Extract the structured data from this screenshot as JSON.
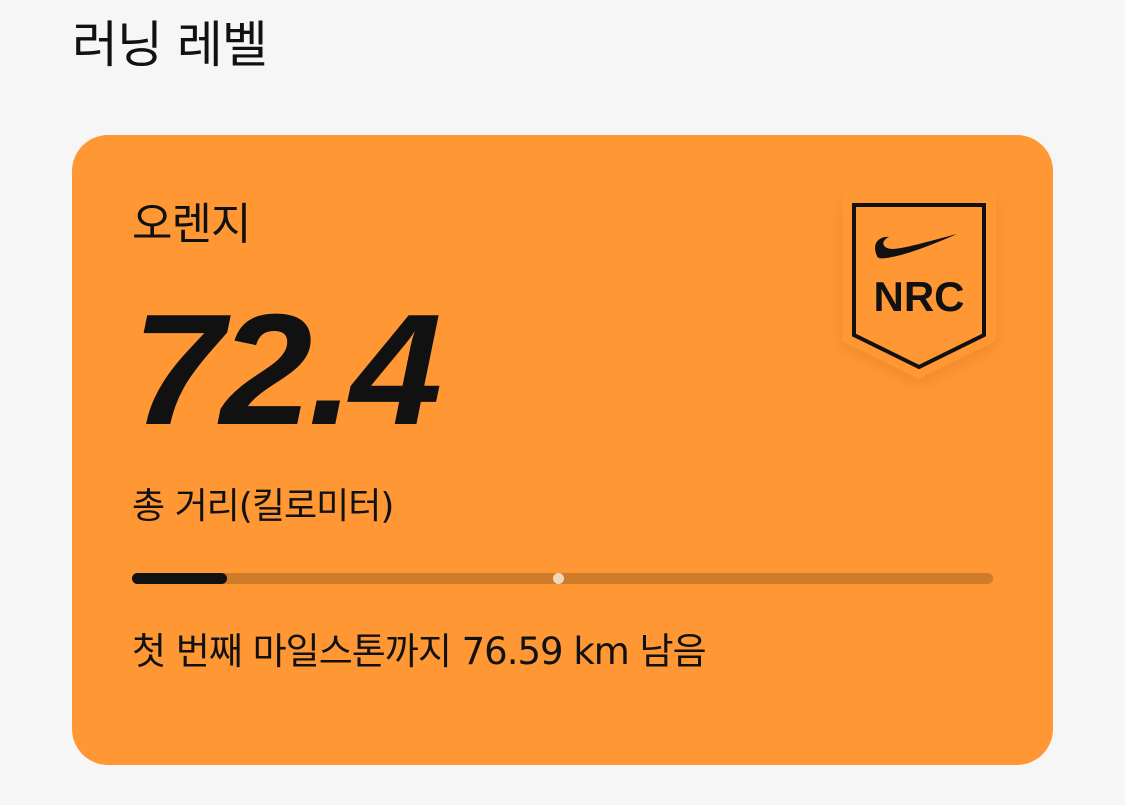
{
  "section": {
    "title": "러닝 레벨"
  },
  "card": {
    "level_name": "오렌지",
    "total_distance": "72.4",
    "distance_label": "총 거리(킬로미터)",
    "progress_fraction": 0.11,
    "milestone_marker_fraction": 0.495,
    "milestone_text": "첫 번째 마일스톤까지 76.59 km 남음",
    "badge": {
      "icon": "nike-swoosh-icon",
      "text": "NRC"
    },
    "colors": {
      "card_background": "#ff9834",
      "progress_track": "#cf7b2c",
      "progress_fill": "#111111",
      "marker": "#f0d7bd"
    }
  }
}
